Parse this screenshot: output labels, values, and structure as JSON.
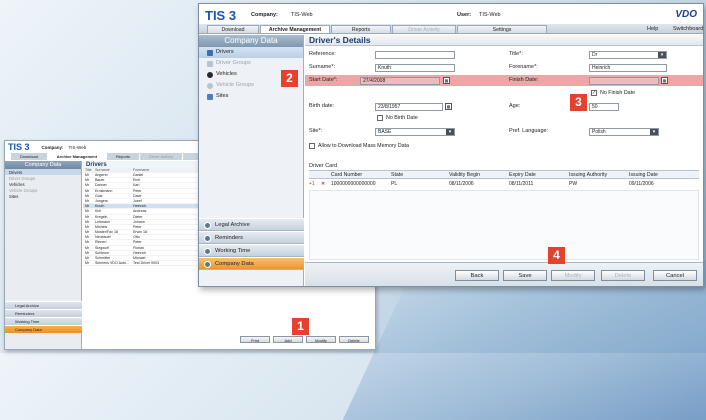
{
  "callouts": [
    "1",
    "2",
    "3",
    "4"
  ],
  "small_window": {
    "logo": "TIS 3",
    "company_label": "Company:",
    "company_value": "TIS-Web",
    "tabs": [
      {
        "label": "Download"
      },
      {
        "label": "Archive Management"
      },
      {
        "label": "Reports"
      },
      {
        "label": "Driver Activity"
      }
    ],
    "sidebar_title": "Company Data",
    "sidebar_items": [
      "Drivers",
      "Driver Groups",
      "Vehicles",
      "Vehicle Groups",
      "Sites"
    ],
    "nav_items": [
      "Legal Archive",
      "Reminders",
      "Working Time",
      "Company Data"
    ],
    "list_title": "Drivers",
    "columns": [
      "Title",
      "Surname",
      "Forename"
    ],
    "rows": [
      [
        "Mr",
        "Angerer",
        "Daniel"
      ],
      [
        "Mr",
        "Bauer",
        "Emil"
      ],
      [
        "Mr",
        "Dahner",
        "Karl"
      ],
      [
        "Mr",
        "Ernstmann",
        "Peter"
      ],
      [
        "Mr",
        "Gutz",
        "Dave"
      ],
      [
        "Mr",
        "Jungers",
        "Josef"
      ],
      [
        "Mr",
        "Knuth",
        "Heinrich"
      ],
      [
        "Mr",
        "Kiel",
        "Andreas"
      ],
      [
        "Mr",
        "Kregeln",
        "Dieter"
      ],
      [
        "Mr",
        "Lehmann",
        "Johann"
      ],
      [
        "Mr",
        "Michels",
        "Peter"
      ],
      [
        "Mr",
        "Muster/Fax 18",
        "Erwin 18"
      ],
      [
        "Mr",
        "Neubauer",
        "Otto"
      ],
      [
        "Mr",
        "Rinnerl",
        "Peter"
      ],
      [
        "Mr",
        "Siegwolf",
        "Florian"
      ],
      [
        "Mr",
        "Schleum",
        "Heinrich"
      ],
      [
        "Mr",
        "Schmitter",
        "Michael"
      ],
      [
        "Mr",
        "Siemens VDO Auto...",
        "Test Driver 0003"
      ]
    ],
    "buttons": [
      "Print",
      "Add",
      "Modify",
      "Delete"
    ]
  },
  "window": {
    "logo": "TIS 3",
    "company_label": "Company:",
    "company_value": "TIS-Web",
    "user_label": "User:",
    "user_value": "TIS-Web",
    "brand": "VDO",
    "tabs": [
      {
        "label": "Download"
      },
      {
        "label": "Archive Management"
      },
      {
        "label": "Reports"
      },
      {
        "label": "Driver Activity"
      },
      {
        "label": "Settings"
      }
    ],
    "help": "Help",
    "switchboard": "Switchboard",
    "sidebar_title": "Company Data",
    "sidebar_items": [
      "Drivers",
      "Driver Groups",
      "Vehicles",
      "Vehicle Groups",
      "Sites"
    ],
    "nav_items": [
      "Legal Archive",
      "Reminders",
      "Working Time",
      "Company Data"
    ],
    "page_title": "Driver's Details",
    "form": {
      "reference_label": "Reference:",
      "reference_value": "",
      "title_label": "Title*:",
      "title_value": "Dr",
      "surname_label": "Surname*:",
      "surname_value": "Knuth",
      "forename_label": "Forename*:",
      "forename_value": "Heinrich",
      "start_date_label": "Start Date*:",
      "start_date_value": "27/4/2008",
      "finish_date_label": "Finish Date:",
      "finish_date_value": "",
      "no_finish_date_label": "No Finish Date",
      "birth_date_label": "Birth date:",
      "birth_date_value": "23/8/1957",
      "age_label": "Age:",
      "age_value": "50",
      "no_birth_date_label": "No Birth Date",
      "site_label": "Site*:",
      "site_value": "BASE",
      "pref_language_label": "Pref. Language:",
      "pref_language_value": "Polish",
      "allow_download_label": "Allow to Download Mass Memory Data"
    },
    "card": {
      "section_title": "Driver Card",
      "columns": [
        "Card Number",
        "State",
        "Validity Begin",
        "Expiry Date",
        "Issuing Authority",
        "Issuing Date"
      ],
      "rows": [
        {
          "card_number": "1000000000000000",
          "state": "PL",
          "validity_begin": "08/11/2006",
          "expiry_date": "08/11/2011",
          "issuing_authority": "PW",
          "issuing_date": "09/11/2006"
        }
      ]
    },
    "buttons": {
      "back": "Back",
      "save": "Save",
      "modify": "Modify",
      "delete": "Delete",
      "cancel": "Cancel"
    }
  }
}
